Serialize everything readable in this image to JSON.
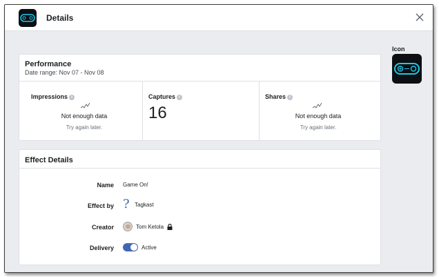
{
  "header": {
    "title": "Details",
    "app_icon": "gamepad-icon",
    "close_icon": "close-icon"
  },
  "performance": {
    "title": "Performance",
    "date_range": "Date range: Nov 07 - Nov 08",
    "metrics": [
      {
        "label": "Impressions",
        "info_icon": "info-icon",
        "sparkline_icon": "sparkline-icon",
        "message": "Not enough data",
        "hint": "Try again later."
      },
      {
        "label": "Captures",
        "info_icon": "info-icon",
        "value": "16"
      },
      {
        "label": "Shares",
        "info_icon": "info-icon",
        "sparkline_icon": "sparkline-icon",
        "message": "Not enough data",
        "hint": "Try again later."
      }
    ]
  },
  "effect_details": {
    "title": "Effect Details",
    "rows": {
      "name": {
        "label": "Name",
        "value": "Game On!"
      },
      "effect_by": {
        "label": "Effect by",
        "value": "Tagkast",
        "icon": "question-mark-icon"
      },
      "creator": {
        "label": "Creator",
        "value": "Tom Ketola",
        "icon": "lock-icon"
      },
      "delivery": {
        "label": "Delivery",
        "value": "Active",
        "toggle_on": true
      }
    }
  },
  "sidebar": {
    "icon_label": "Icon",
    "icon": "gamepad-icon"
  },
  "colors": {
    "accent": "#4267b2",
    "game_icon_glow": "#1fc8e6",
    "game_icon_bg": "#0c0f14"
  }
}
